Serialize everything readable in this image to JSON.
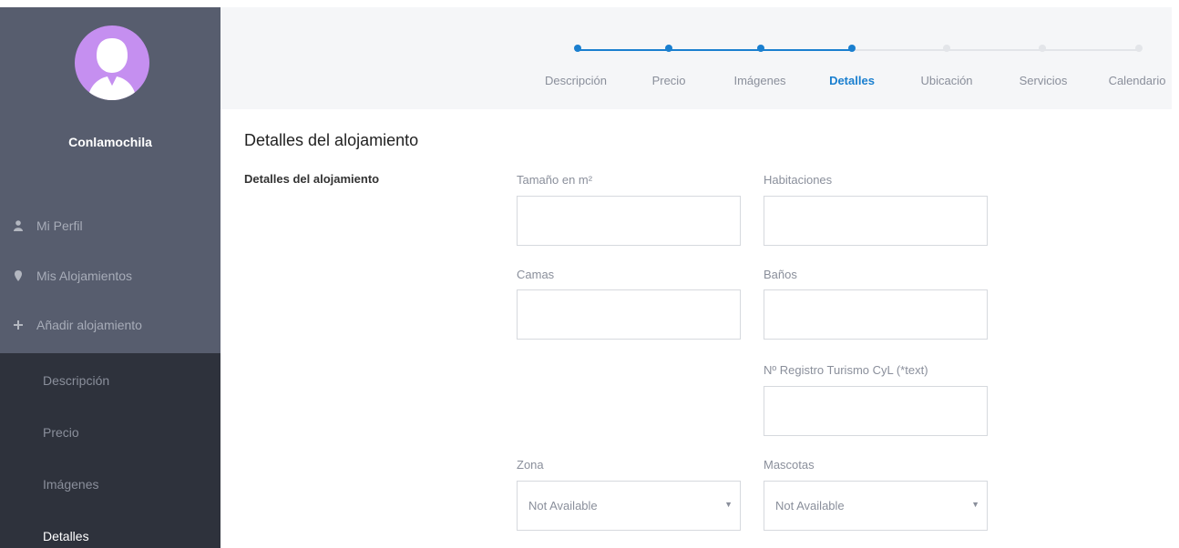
{
  "sidebar": {
    "username": "Conlamochila",
    "nav": [
      {
        "label": "Mi Perfil",
        "icon": "user-icon"
      },
      {
        "label": "Mis Alojamientos",
        "icon": "map-pin-icon"
      },
      {
        "label": "Añadir alojamiento",
        "icon": "plus-icon"
      }
    ],
    "subnav": [
      {
        "label": "Descripción"
      },
      {
        "label": "Precio"
      },
      {
        "label": "Imágenes"
      },
      {
        "label": "Detalles"
      }
    ]
  },
  "stepper": {
    "steps": [
      {
        "label": "Descripción",
        "state": "done"
      },
      {
        "label": "Precio",
        "state": "done"
      },
      {
        "label": "Imágenes",
        "state": "done"
      },
      {
        "label": "Detalles",
        "state": "active"
      },
      {
        "label": "Ubicación",
        "state": "pending"
      },
      {
        "label": "Servicios",
        "state": "pending"
      },
      {
        "label": "Calendario",
        "state": "pending"
      }
    ]
  },
  "main": {
    "title": "Detalles del alojamiento",
    "section_label": "Detalles del alojamiento",
    "fields": {
      "tamano_label": "Tamaño en m²",
      "habitaciones_label": "Habitaciones",
      "camas_label": "Camas",
      "banos_label": "Baños",
      "registro_label": "Nº Registro Turismo CyL (*text)",
      "zona_label": "Zona",
      "zona_value": "Not Available",
      "mascotas_label": "Mascotas",
      "mascotas_value": "Not Available"
    }
  },
  "colors": {
    "sidebar_bg": "#575d6e",
    "subnav_bg": "#2e323c",
    "accent": "#1a7fcf",
    "avatar_bg": "#c58ff0"
  }
}
